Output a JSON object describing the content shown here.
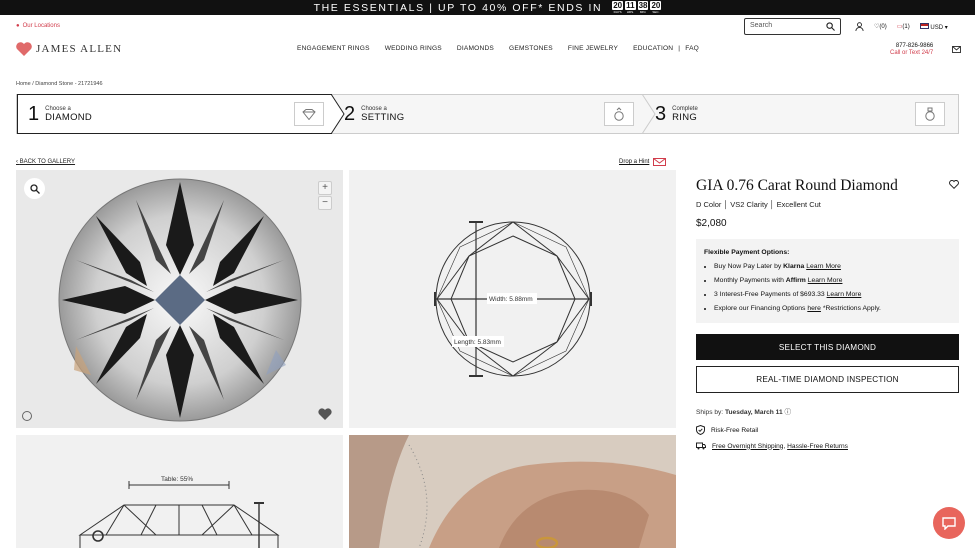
{
  "promo": {
    "text": "THE ESSENTIALS | UP TO 40% OFF* ENDS IN",
    "countdown": [
      {
        "value": "20",
        "unit": "DAYS"
      },
      {
        "value": "11",
        "unit": "HRS."
      },
      {
        "value": "38",
        "unit": "MIN."
      },
      {
        "value": "20",
        "unit": "SEC."
      }
    ]
  },
  "header": {
    "locations": "Our Locations",
    "logo": "JAMES ALLEN",
    "search_placeholder": "Search",
    "wishlist": "(0)",
    "cart": "(1)",
    "currency": "USD",
    "phone": "877-826-9866",
    "text": "Call or Text 24/7"
  },
  "nav": [
    "ENGAGEMENT RINGS",
    "WEDDING RINGS",
    "DIAMONDS",
    "GEMSTONES",
    "FINE JEWELRY",
    "EDUCATION",
    "|",
    "FAQ"
  ],
  "breadcrumb": "Home / Diamond Stone - 21721946",
  "steps": [
    {
      "num": "1",
      "small": "Choose a",
      "big": "DIAMOND"
    },
    {
      "num": "2",
      "small": "Choose a",
      "big": "SETTING"
    },
    {
      "num": "3",
      "small": "Complete",
      "big": "RING"
    }
  ],
  "back": "BACK TO GALLERY",
  "hint": "Drop a Hint",
  "diagram": {
    "width": "Width: 5.88mm",
    "length": "Length: 5.83mm",
    "table": "Table: 55%"
  },
  "product": {
    "title": "GIA 0.76 Carat Round Diamond",
    "color": "D Color",
    "clarity": "VS2 Clarity",
    "cut": "Excellent Cut",
    "price": "$2,080",
    "fin_title": "Flexible Payment Options:",
    "fin": [
      {
        "pre": "Buy Now Pay Later by ",
        "bold": "Klarna",
        "link": "Learn More",
        "post": ""
      },
      {
        "pre": "Monthly Payments with ",
        "bold": "Affirm",
        "link": "Learn More",
        "post": ""
      },
      {
        "pre": "3 Interest-Free Payments of $693.33 ",
        "bold": "",
        "link": "Learn More",
        "post": ""
      },
      {
        "pre": "Explore our Financing Options ",
        "bold": "",
        "link": "here",
        "post": " *Restrictions Apply."
      }
    ],
    "select_btn": "SELECT THIS DIAMOND",
    "inspect_btn": "REAL-TIME DIAMOND INSPECTION",
    "ships_label": "Ships by: ",
    "ships_date": "Tuesday, March 11",
    "perk1": "Risk-Free Retail",
    "perk2a": "Free Overnight Shipping",
    "perk2b": "Hassle-Free Returns"
  }
}
